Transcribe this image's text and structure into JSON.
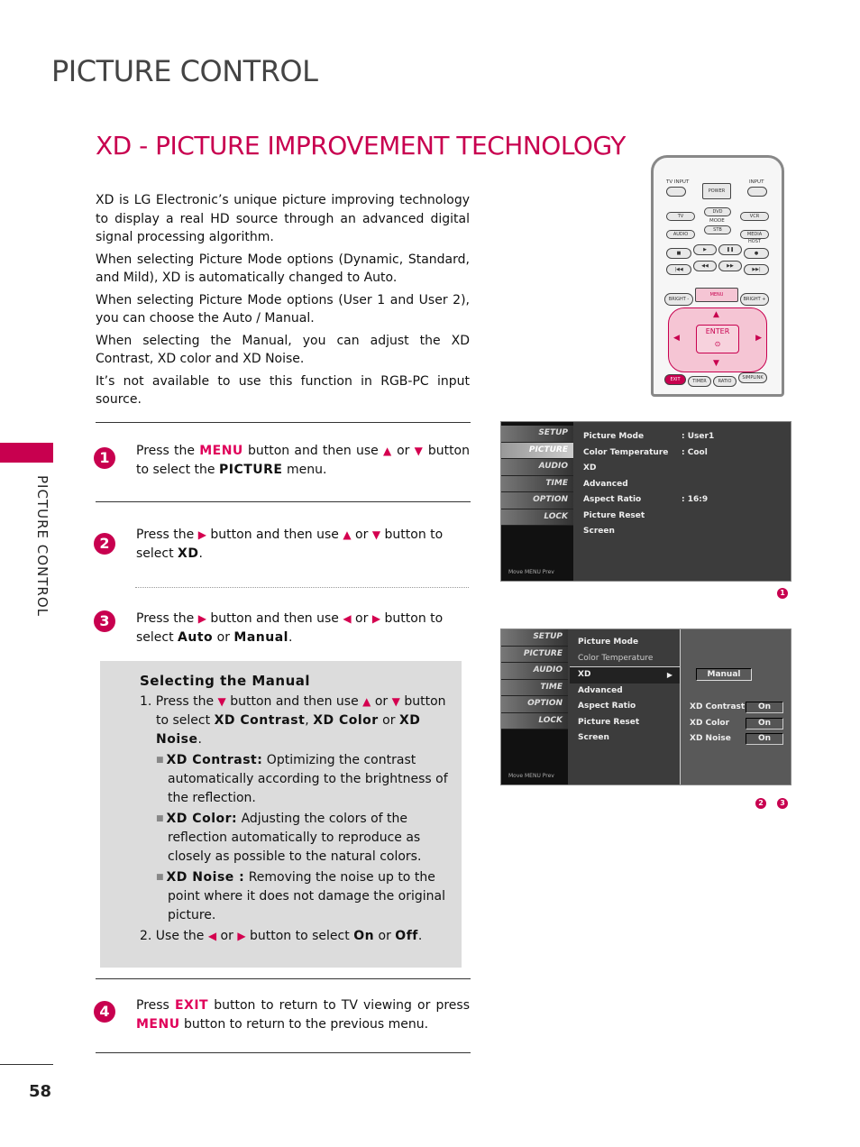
{
  "header": {
    "section_title": "PICTURE CONTROL",
    "page_title": "XD - PICTURE IMPROVEMENT TECHNOLOGY",
    "side_tab_label": "PICTURE CONTROL",
    "accent_color": "#c8004f"
  },
  "intro": [
    "XD is LG Electronic’s unique picture improving technology to display a real HD source through an advanced digital signal processing algorithm.",
    "When selecting Picture Mode options (Dynamic, Standard, and Mild), XD is automatically changed to Auto.",
    "When selecting Picture Mode options (User 1 and User 2), you can choose the Auto / Manual.",
    "When selecting the Manual, you can adjust the XD Contrast, XD color and XD Noise.",
    "It’s not available to use this function in RGB-PC input source."
  ],
  "steps": {
    "s1": {
      "num": "1",
      "a": "Press the ",
      "menu": "MENU",
      "b": " button and then use ",
      "up": "▲",
      "or": " or ",
      "down": "▼",
      "c": " button to select the ",
      "picture": "PICTURE",
      "d": " menu."
    },
    "s2": {
      "num": "2",
      "a": "Press the ",
      "right": "▶",
      "b": " button and then use ",
      "up": "▲",
      "or": " or ",
      "down": "▼",
      "c": " button to select ",
      "xd": "XD",
      "d": "."
    },
    "s3": {
      "num": "3",
      "a": "Press the ",
      "right": "▶",
      "b": " button and then use ",
      "left": "◀",
      "or": " or ",
      "right2": "▶",
      "c": " button to select ",
      "auto": "Auto",
      "or2": " or ",
      "manual": "Manual",
      "d": "."
    },
    "s4": {
      "num": "4",
      "a": "Press ",
      "exit": "EXIT",
      "b": " button to return to TV viewing or press ",
      "menu": "MENU",
      "c": " button to return to the previous menu."
    }
  },
  "manual": {
    "title": "Selecting the Manual",
    "item1": {
      "a": "1. Press the ",
      "down": "▼",
      "b": " button and then use ",
      "up": "▲",
      "or": " or ",
      "down2": "▼",
      "c": " button to select ",
      "contrast": "XD Contrast",
      "comma": ", ",
      "color": "XD Color",
      "or2": " or ",
      "noise": "XD Noise",
      "d": "."
    },
    "bullets": [
      {
        "term": "XD Contrast:",
        "text": " Optimizing the contrast automatically according to the brightness of the reflection."
      },
      {
        "term": "XD Color:",
        "text": " Adjusting the colors of the reflection automatically to reproduce as closely as possible to the natural colors."
      },
      {
        "term": "XD Noise :",
        "text": " Removing the noise up to the point where it does not damage the original picture."
      }
    ],
    "item2": {
      "a": "2. Use the ",
      "left": "◀",
      "or": " or ",
      "right": "▶",
      "b": " button to select ",
      "on": "On",
      "or2": " or ",
      "off": "Off",
      "c": "."
    }
  },
  "tv_menu_1": {
    "sidebar": [
      "SETUP",
      "PICTURE",
      "AUDIO",
      "TIME",
      "OPTION",
      "LOCK"
    ],
    "selected": "PICTURE",
    "footer": "Move   MENU Prev",
    "rows": [
      {
        "label": "Picture Mode",
        "value": ": User1"
      },
      {
        "label": "Color Temperature",
        "value": ": Cool"
      },
      {
        "label": "XD",
        "value": ""
      },
      {
        "label": "Advanced",
        "value": ""
      },
      {
        "label": "Aspect Ratio",
        "value": ": 16:9"
      },
      {
        "label": "Picture Reset",
        "value": ""
      },
      {
        "label": "Screen",
        "value": ""
      }
    ],
    "tag": "1"
  },
  "tv_menu_2": {
    "sidebar": [
      "SETUP",
      "PICTURE",
      "AUDIO",
      "TIME",
      "OPTION",
      "LOCK"
    ],
    "footer": "Move   MENU Prev",
    "rows": [
      "Picture Mode",
      "Color Temperature",
      "XD",
      "Advanced",
      "Aspect Ratio",
      "Picture Reset",
      "Screen"
    ],
    "highlighted": "XD",
    "arrow": "▶",
    "mode_value": "Manual",
    "settings": [
      {
        "label": "XD Contrast",
        "value": "On"
      },
      {
        "label": "XD Color",
        "value": "On"
      },
      {
        "label": "XD Noise",
        "value": "On"
      }
    ],
    "tags": [
      "2",
      "3"
    ]
  },
  "remote": {
    "tv_input": "TV INPUT",
    "power": "POWER",
    "input": "INPUT",
    "mode_row1": [
      "TV",
      "DVD",
      "VCR"
    ],
    "mode_label": "MODE",
    "mode_row2": [
      "AUDIO",
      "STB",
      "MEDIA HOST"
    ],
    "transport1": [
      "■",
      "▶",
      "❚❚",
      "●"
    ],
    "transport2": [
      "|◀◀",
      "◀◀",
      "▶▶",
      "▶▶|"
    ],
    "bright_minus": "BRIGHT -",
    "menu": "MENU",
    "bright_plus": "BRIGHT +",
    "enter": "ENTER",
    "bottom": [
      "EXIT",
      "TIMER",
      "RATIO",
      "SIMPLINK"
    ]
  },
  "page_number": "58"
}
